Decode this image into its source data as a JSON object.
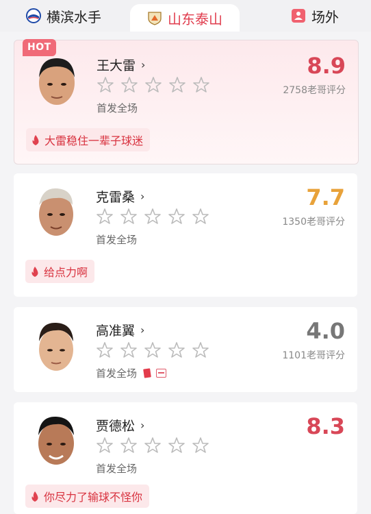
{
  "tabs": [
    {
      "label": "横滨水手",
      "icon": "yokohama-badge-icon",
      "active": false
    },
    {
      "label": "山东泰山",
      "icon": "taishan-badge-icon",
      "active": true
    },
    {
      "label": "场外",
      "icon": "fan-icon",
      "active": false
    }
  ],
  "players": [
    {
      "name": "王大雷",
      "score": "8.9",
      "raters": "2758老哥评分",
      "status": "首发全场",
      "comment": "大雷稳住一辈子球迷",
      "hot_label": "HOT",
      "score_color": "#d84757"
    },
    {
      "name": "克雷桑",
      "score": "7.7",
      "raters": "1350老哥评分",
      "status": "首发全场",
      "comment": "给点力啊",
      "score_color": "#e8a23a"
    },
    {
      "name": "高准翼",
      "score": "4.0",
      "raters": "1101老哥评分",
      "status": "首发全场",
      "comment": "",
      "score_color": "#777777"
    },
    {
      "name": "贾德松",
      "score": "8.3",
      "raters": "",
      "status": "首发全场",
      "comment": "你尽力了输球不怪你",
      "score_color": "#d84757"
    }
  ],
  "colors": {
    "accent": "#e03c4d",
    "hot": "#f06a78"
  }
}
